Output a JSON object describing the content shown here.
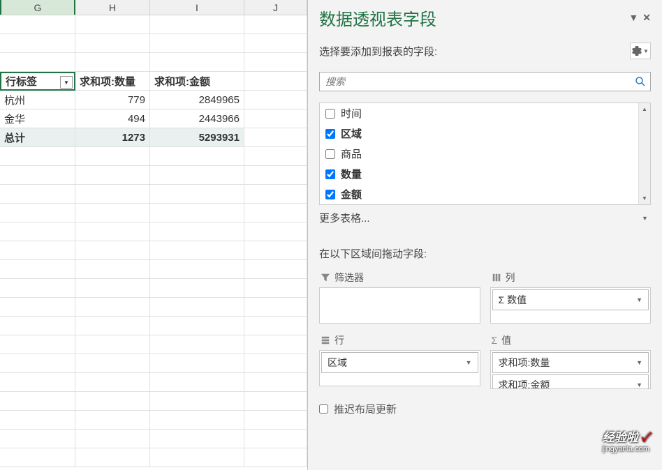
{
  "spreadsheet": {
    "columns": [
      "G",
      "H",
      "I",
      "J"
    ],
    "pivotHeaders": {
      "rowLabel": "行标签",
      "sumQty": "求和项:数量",
      "sumAmount": "求和项:金额"
    },
    "rows": [
      {
        "label": "杭州",
        "qty": "779",
        "amount": "2849965"
      },
      {
        "label": "金华",
        "qty": "494",
        "amount": "2443966"
      }
    ],
    "total": {
      "label": "总计",
      "qty": "1273",
      "amount": "5293931"
    }
  },
  "panel": {
    "title": "数据透视表字段",
    "subtitle": "选择要添加到报表的字段:",
    "searchPlaceholder": "搜索",
    "fields": [
      {
        "name": "时间",
        "checked": false
      },
      {
        "name": "区域",
        "checked": true
      },
      {
        "name": "商品",
        "checked": false
      },
      {
        "name": "数量",
        "checked": true
      },
      {
        "name": "金额",
        "checked": true
      }
    ],
    "moreTables": "更多表格...",
    "dragTitle": "在以下区域间拖动字段:",
    "zones": {
      "filter": "筛选器",
      "columns": "列",
      "rows": "行",
      "values": "值"
    },
    "columnItems": [
      "数值"
    ],
    "rowItems": [
      "区域"
    ],
    "valueItems": [
      "求和项:数量",
      "求和项:金额"
    ],
    "deferLayout": "推迟布局更新"
  },
  "watermark": {
    "main": "经验啦",
    "check": "✓",
    "sub": "jingyanla.com"
  }
}
